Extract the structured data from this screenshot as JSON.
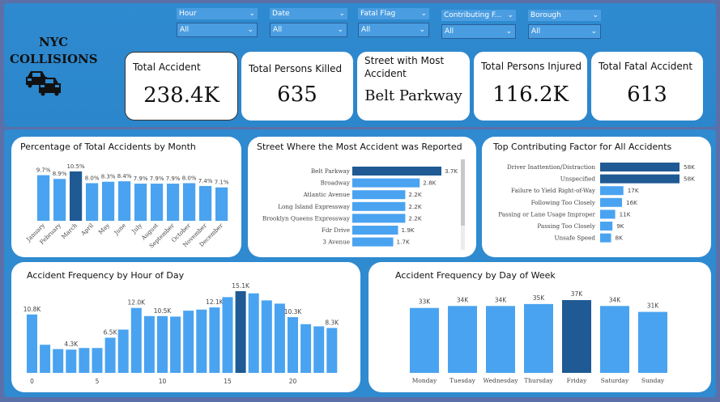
{
  "app": {
    "title_line1": "NYC",
    "title_line2": "COLLISIONS"
  },
  "slicers": [
    {
      "label": "Hour",
      "value": "All"
    },
    {
      "label": "Date",
      "value": "All"
    },
    {
      "label": "Fatal Flag",
      "value": "All"
    },
    {
      "label": "Contributing F...",
      "value": "All"
    },
    {
      "label": "Borough",
      "value": "All"
    }
  ],
  "kpis": {
    "total_accident": {
      "label": "Total Accident",
      "value": "238.4K"
    },
    "persons_killed": {
      "label": "Total Persons Killed",
      "value": "635"
    },
    "street_most": {
      "label": "Street with Most Accident",
      "value": "Belt Parkway"
    },
    "persons_injured": {
      "label": "Total Persons Injured",
      "value": "116.2K"
    },
    "fatal_accident": {
      "label": "Total Fatal Accident",
      "value": "613"
    }
  },
  "colors": {
    "bar": "#4aa3f0",
    "highlight": "#1f5a94",
    "track": "#c8c8c8"
  },
  "chart_data": [
    {
      "id": "month",
      "type": "bar",
      "title": "Percentage of Total Accidents by Month",
      "categories": [
        "January",
        "February",
        "March",
        "April",
        "May",
        "June",
        "July",
        "August",
        "September",
        "October",
        "November",
        "December"
      ],
      "values": [
        9.7,
        8.9,
        10.5,
        8.0,
        8.3,
        8.4,
        7.9,
        7.9,
        7.9,
        8.0,
        7.4,
        7.1
      ],
      "labels": [
        "9.7%",
        "8.9%",
        "10.5%",
        "8.0%",
        "8.3%",
        "8.4%",
        "7.9%",
        "7.9%",
        "7.9%",
        "8.0%",
        "7.4%",
        "7.1%"
      ],
      "highlight_index": 2
    },
    {
      "id": "street",
      "type": "bar",
      "orientation": "horizontal",
      "title": "Street Where the Most Accident was Reported",
      "categories": [
        "Belt Parkway",
        "Broadway",
        "Atlantic Avenue",
        "Long Island Expressway",
        "Brooklyn Queens Expressway",
        "Fdr Drive",
        "3 Avenue"
      ],
      "values": [
        3.7,
        2.8,
        2.2,
        2.2,
        2.2,
        1.9,
        1.7
      ],
      "labels": [
        "3.7K",
        "2.8K",
        "2.2K",
        "2.2K",
        "2.2K",
        "1.9K",
        "1.7K"
      ],
      "highlight_index": 0
    },
    {
      "id": "factor",
      "type": "bar",
      "orientation": "horizontal",
      "title": "Top Contributing Factor for All Accidents",
      "categories": [
        "Driver Inattention/Distraction",
        "Unspecified",
        "Failure to Yield Right-of-Way",
        "Following Too Closely",
        "Passing or Lane Usage Improper",
        "Passing Too Closely",
        "Unsafe Speed"
      ],
      "values": [
        58,
        58,
        17,
        16,
        11,
        9,
        8
      ],
      "labels": [
        "58K",
        "58K",
        "17K",
        "16K",
        "11K",
        "9K",
        "8K"
      ],
      "highlight_index": [
        0,
        1
      ]
    },
    {
      "id": "hour",
      "type": "bar",
      "title": "Accident Frequency by Hour of Day",
      "x": [
        0,
        1,
        2,
        3,
        4,
        5,
        6,
        7,
        8,
        9,
        10,
        11,
        12,
        13,
        14,
        15,
        16,
        17,
        18,
        19,
        20,
        21,
        22,
        23
      ],
      "values": [
        10.8,
        5.2,
        4.4,
        4.3,
        4.6,
        4.6,
        6.5,
        8.0,
        12.0,
        10.5,
        10.5,
        10.4,
        11.5,
        11.7,
        12.1,
        14.0,
        15.1,
        14.7,
        13.4,
        12.8,
        10.3,
        9.0,
        8.6,
        8.3
      ],
      "data_labels": {
        "0": "10.8K",
        "3": "4.3K",
        "6": "6.5K",
        "8": "12.0K",
        "10": "10.5K",
        "14": "12.1K",
        "16": "15.1K",
        "20": "10.3K",
        "23": "8.3K"
      },
      "xticks": [
        "0",
        "5",
        "10",
        "15",
        "20"
      ],
      "highlight_index": 16
    },
    {
      "id": "weekday",
      "type": "bar",
      "title": "Accident Frequency by Day of Week",
      "categories": [
        "Monday",
        "Tuesday",
        "Wednesday",
        "Thursday",
        "Friday",
        "Saturday",
        "Sunday"
      ],
      "values": [
        33,
        34,
        34,
        35,
        37,
        34,
        31
      ],
      "labels": [
        "33K",
        "34K",
        "34K",
        "35K",
        "37K",
        "34K",
        "31K"
      ],
      "highlight_index": 4
    }
  ]
}
